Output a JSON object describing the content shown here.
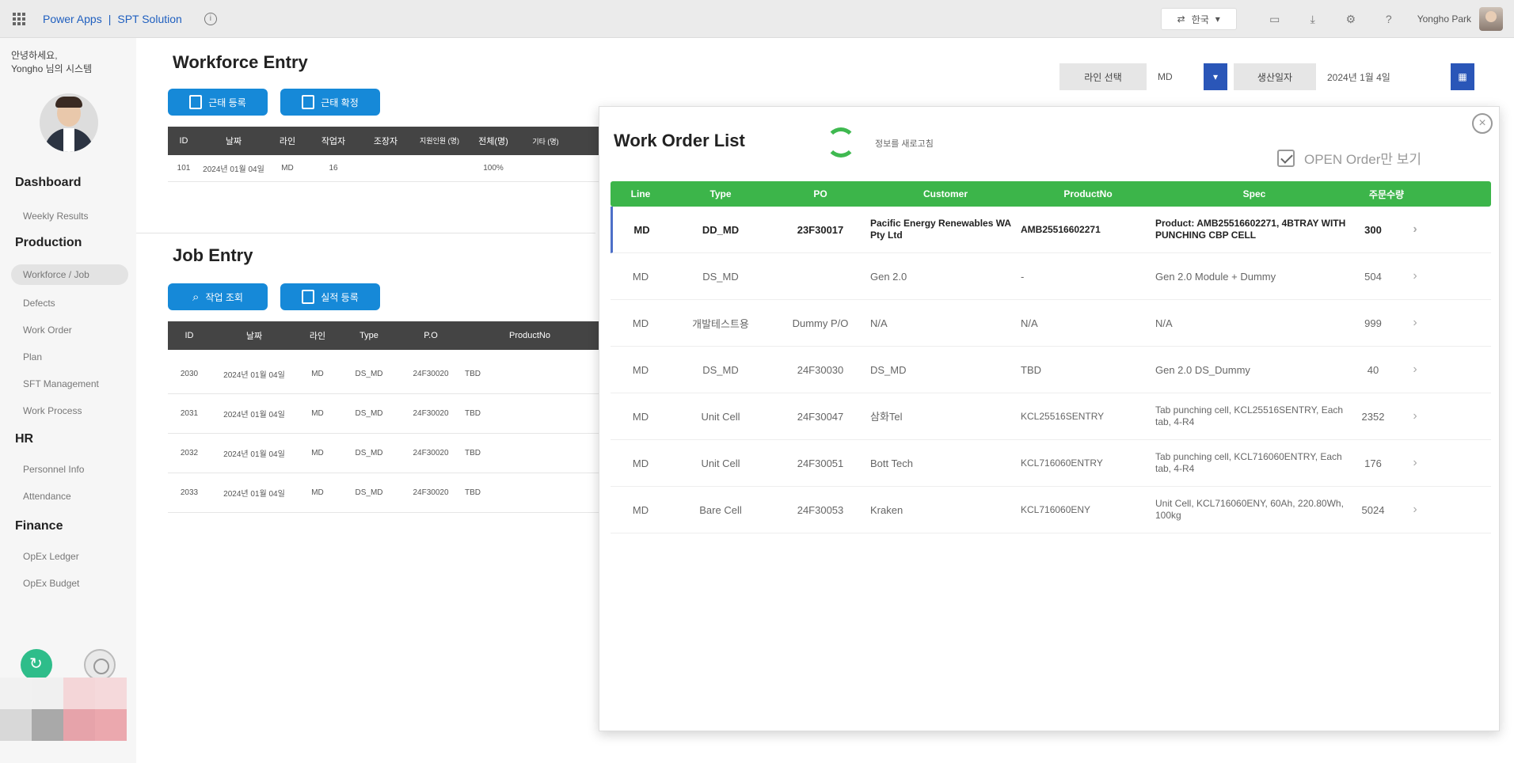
{
  "topbar": {
    "app_name": "Power Apps",
    "separator": "|",
    "solution_name": "SPT Solution",
    "language": "한국",
    "user_name": "Yongho Park"
  },
  "sidebar": {
    "greeting_line1": "안녕하세요,",
    "greeting_line2": "Yongho 님의 시스템",
    "sections": [
      {
        "title": "Dashboard",
        "items": [
          "Weekly Results"
        ]
      },
      {
        "title": "Production",
        "items": [
          "Workforce / Job",
          "Defects",
          "Work Order",
          "Plan",
          "SFT Management",
          "Work Process"
        ]
      },
      {
        "title": "HR",
        "items": [
          "Personnel Info",
          "Attendance"
        ]
      },
      {
        "title": "Finance",
        "items": [
          "OpEx Ledger",
          "OpEx Budget"
        ]
      }
    ],
    "active_item": "Workforce / Job"
  },
  "workforce": {
    "title": "Workforce Entry",
    "buttons": [
      "근태 등록",
      "근태 확정"
    ],
    "columns": [
      "ID",
      "날짜",
      "라인",
      "작업자",
      "조장자",
      "지원인원 (명)",
      "전체(명)",
      "기타 (명)"
    ],
    "rows": [
      [
        "101",
        "2024년 01월 04일",
        "MD",
        "16",
        "",
        "",
        "100%",
        ""
      ]
    ]
  },
  "job": {
    "title": "Job Entry",
    "buttons": [
      "작업 조회",
      "실적 등록"
    ],
    "columns": [
      "ID",
      "날짜",
      "라인",
      "Type",
      "P.O",
      "ProductNo"
    ],
    "rows": [
      [
        "2030",
        "2024년 01월 04일",
        "MD",
        "DS_MD",
        "24F30020",
        "TBD"
      ],
      [
        "2031",
        "2024년 01월 04일",
        "MD",
        "DS_MD",
        "24F30020",
        "TBD"
      ],
      [
        "2032",
        "2024년 01월 04일",
        "MD",
        "DS_MD",
        "24F30020",
        "TBD"
      ],
      [
        "2033",
        "2024년 01월 04일",
        "MD",
        "DS_MD",
        "24F30020",
        "TBD"
      ]
    ]
  },
  "filters": {
    "line_label": "라인 선택",
    "line_value": "MD",
    "date_label": "생산일자",
    "date_value": "2024년 1월 4일",
    "icon_label": "▾"
  },
  "work_order": {
    "title": "Work Order List",
    "refresh_caption": "정보를 새로고침",
    "open_order_label": "OPEN Order만 보기",
    "columns": [
      "Line",
      "Type",
      "PO",
      "Customer",
      "ProductNo",
      "Spec",
      "주문수량"
    ],
    "rows": [
      {
        "line": "MD",
        "type": "DD_MD",
        "po": "23F30017",
        "customer": "Pacific Energy Renewables WA Pty Ltd",
        "product": "AMB25516602271",
        "spec": "Product: AMB25516602271, 4BTRAY WITH PUNCHING CBP CELL",
        "qty": "300"
      },
      {
        "line": "MD",
        "type": "DS_MD",
        "po": "",
        "customer": "Gen 2.0",
        "product": "-",
        "spec": "Gen 2.0 Module + Dummy",
        "qty": "504"
      },
      {
        "line": "MD",
        "type": "개발테스트용",
        "po": "Dummy P/O",
        "customer": "N/A",
        "product": "N/A",
        "spec": "N/A",
        "qty": "999"
      },
      {
        "line": "MD",
        "type": "DS_MD",
        "po": "24F30030",
        "customer": "DS_MD",
        "product": "TBD",
        "spec": "Gen 2.0 DS_Dummy",
        "qty": "40"
      },
      {
        "line": "MD",
        "type": "Unit Cell",
        "po": "24F30047",
        "customer": "삼화Tel",
        "product": "KCL25516SENTRY",
        "spec": "Tab punching cell, KCL25516SENTRY, Each tab, 4-R4",
        "qty": "2352"
      },
      {
        "line": "MD",
        "type": "Unit Cell",
        "po": "24F30051",
        "customer": "Bott Tech",
        "product": "KCL716060ENTRY",
        "spec": "Tab punching cell, KCL716060ENTRY, Each tab, 4-R4",
        "qty": "176"
      },
      {
        "line": "MD",
        "type": "Bare Cell",
        "po": "24F30053",
        "customer": "Kraken",
        "product": "KCL716060ENY",
        "spec": "Unit Cell, KCL716060ENY, 60Ah, 220.80Wh, 100kg",
        "qty": "5024"
      }
    ]
  },
  "colors": {
    "accent_blue": "#1689d8",
    "header_green": "#3cb54a",
    "table_header_dark": "#444444",
    "selection_bar": "#4d6fc8"
  }
}
